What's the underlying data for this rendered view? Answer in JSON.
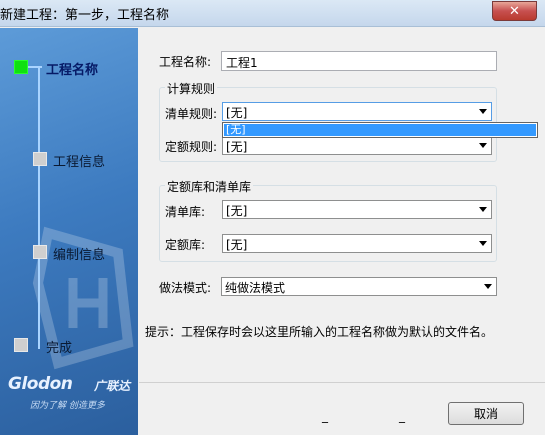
{
  "window": {
    "title": "新建工程：第一步，工程名称",
    "close_glyph": "✕"
  },
  "sidebar": {
    "steps": [
      {
        "label": "工程名称",
        "active": true
      },
      {
        "label": "工程信息",
        "active": false
      },
      {
        "label": "编制信息",
        "active": false
      },
      {
        "label": "完成",
        "active": false
      }
    ],
    "brand": {
      "logo": "Glodon",
      "logo_cn": "广联达",
      "slogan": "因为了解  创造更多"
    }
  },
  "form": {
    "project_name": {
      "label": "工程名称:",
      "value": "工程1"
    },
    "calc_rules": {
      "title": "计算规则",
      "list_rule": {
        "label": "清单规则:",
        "value": "[无]"
      },
      "quota_rule": {
        "label": "定额规则:",
        "value": "[无]"
      }
    },
    "libraries": {
      "title": "定额库和清单库",
      "list_lib": {
        "label": "清单库:",
        "value": "[无]"
      },
      "quota_lib": {
        "label": "定额库:",
        "value": "[无]"
      }
    },
    "method": {
      "label": "做法模式:",
      "value": "纯做法模式"
    },
    "dropdown_options": [
      "[无]"
    ]
  },
  "hint": "提示：工程保存时会以这里所输入的工程名称做为默认的文件名。",
  "footer": {
    "dash1": "_",
    "dash2": "_",
    "cancel": "取消"
  },
  "colors": {
    "sidebar_top": "#5d9bd8",
    "sidebar_bottom": "#2b5f9e",
    "active_step": "#10e010",
    "selection": "#3399ff"
  }
}
